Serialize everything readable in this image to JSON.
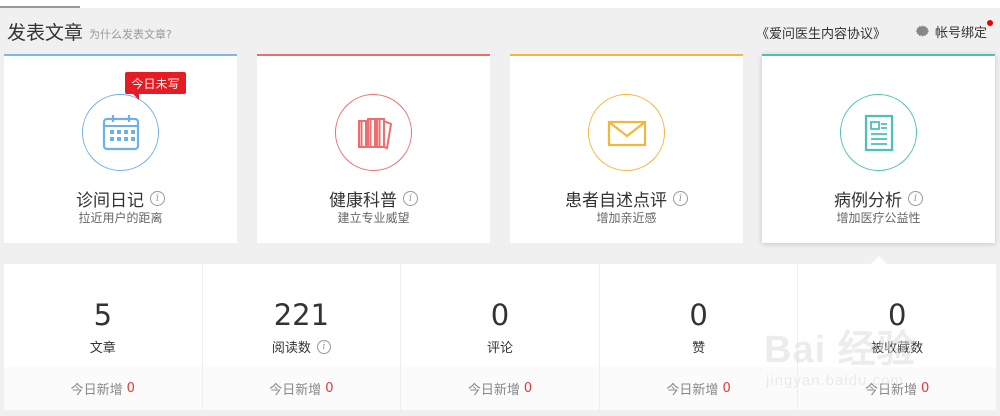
{
  "header": {
    "title": "发表文章",
    "subtitle": "为什么发表文章?",
    "agreement": "《爱问医生内容协议》",
    "account": "帐号绑定"
  },
  "cards": [
    {
      "title": "诊间日记",
      "desc": "拉近用户的距离",
      "icon": "calendar-icon",
      "color": "#6fb0e6",
      "badge": "今日未写"
    },
    {
      "title": "健康科普",
      "desc": "建立专业威望",
      "icon": "books-icon",
      "color": "#ee6e6e"
    },
    {
      "title": "患者自述点评",
      "desc": "增加亲近感",
      "icon": "envelope-icon",
      "color": "#f5b53c"
    },
    {
      "title": "病例分析",
      "desc": "增加医疗公益性",
      "icon": "document-icon",
      "color": "#4cc1b8"
    }
  ],
  "stats": [
    {
      "value": "5",
      "label": "文章",
      "today_label": "今日新增",
      "today": "0"
    },
    {
      "value": "221",
      "label": "阅读数",
      "today_label": "今日新增",
      "today": "0"
    },
    {
      "value": "0",
      "label": "评论",
      "today_label": "今日新增",
      "today": "0"
    },
    {
      "value": "0",
      "label": "赞",
      "today_label": "今日新增",
      "today": "0"
    },
    {
      "value": "0",
      "label": "被收藏数",
      "today_label": "今日新增",
      "today": "0"
    }
  ],
  "watermark": {
    "brand": "Bai 经验",
    "url": "jingyan.baidu.com"
  },
  "info_glyph": "i"
}
